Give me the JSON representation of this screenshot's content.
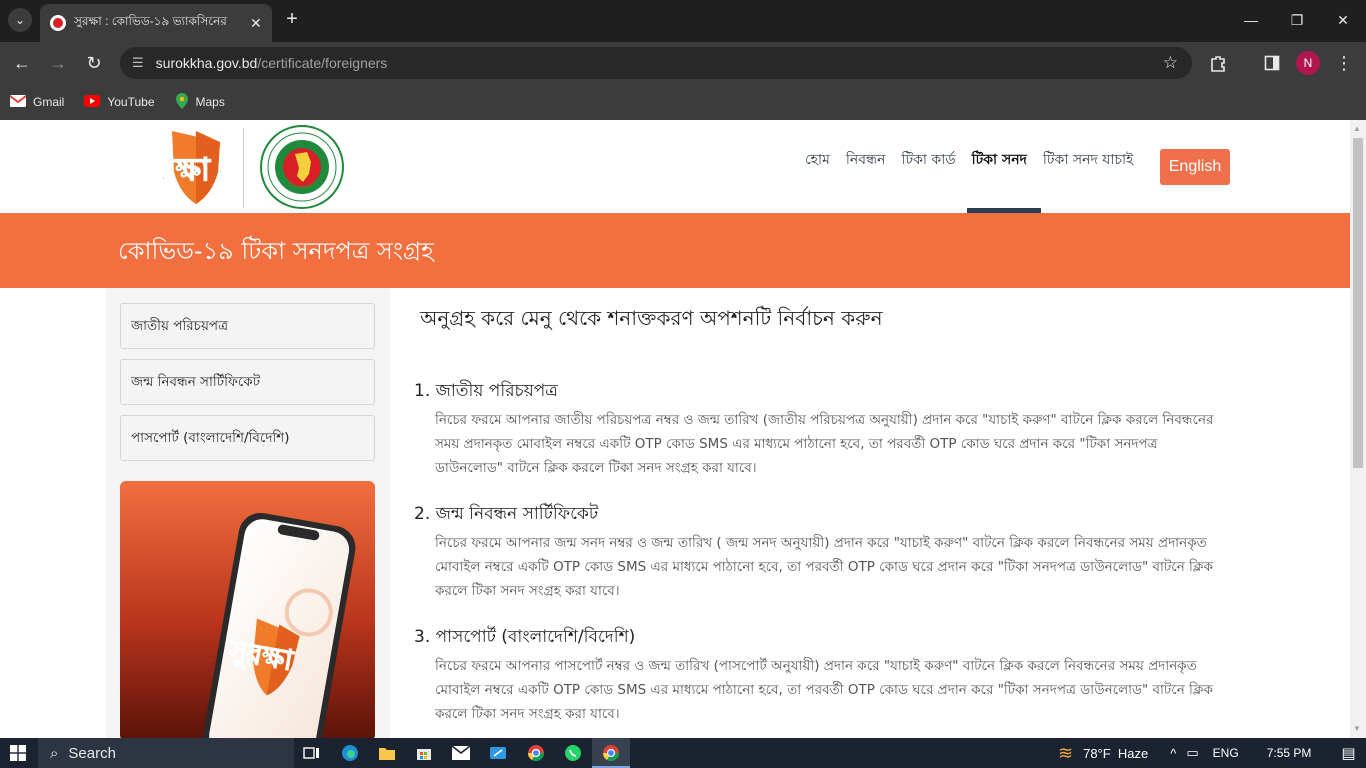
{
  "browser": {
    "tab_title": "সুরক্ষা : কোভিড-১৯ ভ্যাকসিনের",
    "tab_close": "✕",
    "new_tab": "+",
    "url_host": "surokkha.gov.bd",
    "url_path": "/certificate/foreigners",
    "profile_initial": "N",
    "bookmarks": [
      "Gmail",
      "YouTube",
      "Maps"
    ]
  },
  "header": {
    "logo_text": "সুরক্ষা",
    "nav": [
      "হোম",
      "নিবন্ধন",
      "টিকা কার্ড",
      "টিকা সনদ",
      "টিকা সনদ যাচাই"
    ],
    "active_nav": "টিকা সনদ",
    "lang_button": "English"
  },
  "banner": {
    "title": "কোভিড-১৯ টিকা সনদপত্র সংগ্রহ"
  },
  "sidebar": {
    "items": [
      "জাতীয় পরিচয়পত্র",
      "জন্ম নিবন্ধন সার্টিফিকেট",
      "পাসপোর্ট (বাংলাদেশি/বিদেশি)"
    ],
    "promo_logo_text": "সুরক্ষা"
  },
  "content": {
    "heading": "অনুগ্রহ করে মেনু থেকে শনাক্তকরণ অপশনটি নির্বাচন করুন",
    "sections": [
      {
        "title": "1. জাতীয় পরিচয়পত্র",
        "body": "নিচের ফরমে আপনার জাতীয় পরিচয়পত্র নম্বর ও জন্ম তারিখ (জাতীয় পরিচয়পত্র অনুযায়ী) প্রদান করে \"যাচাই করুণ\" বাটনে ক্লিক করলে নিবন্ধনের সময় প্রদানকৃত মোবাইল নম্বরে একটি OTP কোড SMS এর মাধ্যমে পাঠানো হবে, তা পরবর্তী OTP কোড ঘরে প্রদান করে \"টিকা সনদপত্র ডাউনলোড\" বাটনে ক্লিক করলে টিকা সনদ সংগ্রহ করা যাবে।"
      },
      {
        "title": "2. জন্ম নিবন্ধন সার্টিফিকেট",
        "body": "নিচের ফরমে আপনার জন্ম সনদ নম্বর ও জন্ম তারিখ ( জন্ম সনদ অনুযায়ী) প্রদান করে \"যাচাই করুণ\" বাটনে ক্লিক করলে নিবন্ধনের সময় প্রদানকৃত মোবাইল নম্বরে একটি OTP কোড SMS এর মাধ্যমে পাঠানো হবে, তা পরবর্তী OTP কোড ঘরে প্রদান করে \"টিকা সনদপত্র ডাউনলোড\" বাটনে ক্লিক করলে টিকা সনদ সংগ্রহ করা যাবে।"
      },
      {
        "title": "3. পাসপোর্ট (বাংলাদেশি/বিদেশি)",
        "body": "নিচের ফরমে আপনার পাসপোর্ট নম্বর ও জন্ম তারিখ (পাসপোর্ট অনুযায়ী) প্রদান করে \"যাচাই করুণ\" বাটনে ক্লিক করলে নিবন্ধনের সময় প্রদানকৃত মোবাইল নম্বরে একটি OTP কোড SMS এর মাধ্যমে পাঠানো হবে, তা পরবর্তী OTP কোড ঘরে প্রদান করে \"টিকা সনদপত্র ডাউনলোড\" বাটনে ক্লিক করলে টিকা সনদ সংগ্রহ করা যাবে।"
      }
    ]
  },
  "taskbar": {
    "search_label": "Search",
    "weather": "78°F  Haze",
    "language": "ENG",
    "time": "7:55 PM"
  },
  "colors": {
    "accent_orange": "#f26f3f",
    "logo_green": "#3aa635",
    "seal_red": "#d81f26"
  }
}
